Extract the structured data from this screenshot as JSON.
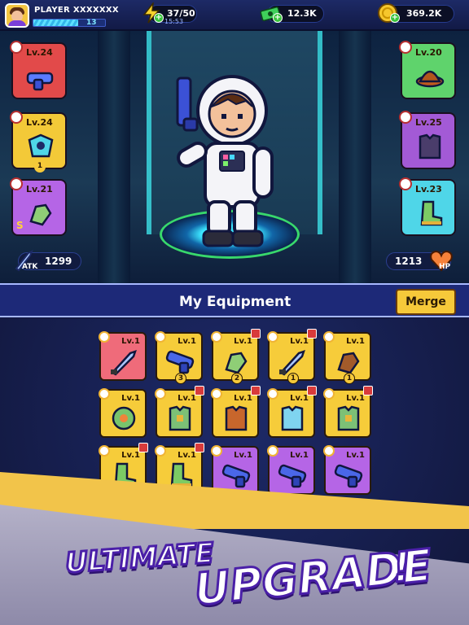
{
  "player": {
    "name": "PLAYER XXXXXXX",
    "level": "13",
    "xp_progress": 0.62
  },
  "resources": {
    "energy": {
      "value": "37/50",
      "timer": "15:53",
      "icon": "lightning-icon"
    },
    "cash": {
      "value": "12.3K",
      "icon": "cash-icon"
    },
    "coins": {
      "value": "369.2K",
      "icon": "coin-icon"
    }
  },
  "equipped_left": [
    {
      "slot": "weapon",
      "level": "Lv.24",
      "color": "#e24a4a"
    },
    {
      "slot": "armor-plate",
      "level": "Lv.24",
      "color": "#f3c938",
      "badge": "1"
    },
    {
      "slot": "glove",
      "level": "Lv.21",
      "color": "#b565e6",
      "rank": "S"
    }
  ],
  "equipped_right": [
    {
      "slot": "helmet",
      "level": "Lv.20",
      "color": "#5fd36c"
    },
    {
      "slot": "vest",
      "level": "Lv.25",
      "color": "#a35ad6"
    },
    {
      "slot": "boots",
      "level": "Lv.23",
      "color": "#4fd6e8"
    }
  ],
  "stats": {
    "atk_label": "ATK",
    "atk_value": "1299",
    "hp_label": "HP",
    "hp_value": "1213"
  },
  "equipment_panel": {
    "title": "My Equipment",
    "merge_label": "Merge"
  },
  "inventory": [
    {
      "level": "Lv.1",
      "item": "knife",
      "color": "#ef6b7a"
    },
    {
      "level": "Lv.1",
      "item": "blaster",
      "color": "#f6cc3a",
      "count": "3"
    },
    {
      "level": "Lv.1",
      "item": "glove",
      "color": "#f6cc3a",
      "count": "2",
      "gift": true
    },
    {
      "level": "Lv.1",
      "item": "knife",
      "color": "#f6cc3a",
      "count": "1",
      "gift": true
    },
    {
      "level": "Lv.1",
      "item": "brown-glove",
      "color": "#f6cc3a",
      "count": "1"
    },
    {
      "level": "Lv.1",
      "item": "shield",
      "color": "#f6cc3a"
    },
    {
      "level": "Lv.1",
      "item": "green-vest",
      "color": "#f6cc3a",
      "gift": true
    },
    {
      "level": "Lv.1",
      "item": "orange-vest",
      "color": "#f6cc3a",
      "gift": true
    },
    {
      "level": "Lv.1",
      "item": "blue-vest",
      "color": "#f6cc3a",
      "gift": true
    },
    {
      "level": "Lv.1",
      "item": "green-vest",
      "color": "#f6cc3a",
      "gift": true
    },
    {
      "level": "Lv.1",
      "item": "boots",
      "color": "#f6cc3a",
      "gift": true
    },
    {
      "level": "Lv.1",
      "item": "boots",
      "color": "#f6cc3a",
      "gift": true
    },
    {
      "level": "Lv.1",
      "item": "blaster",
      "color": "#b565e6"
    },
    {
      "level": "Lv.1",
      "item": "blaster",
      "color": "#b565e6"
    },
    {
      "level": "Lv.1",
      "item": "blaster",
      "color": "#b565e6"
    }
  ],
  "promo": {
    "word1": "ULTIMATE",
    "word2": "UPGRADE",
    "word3": "!"
  }
}
